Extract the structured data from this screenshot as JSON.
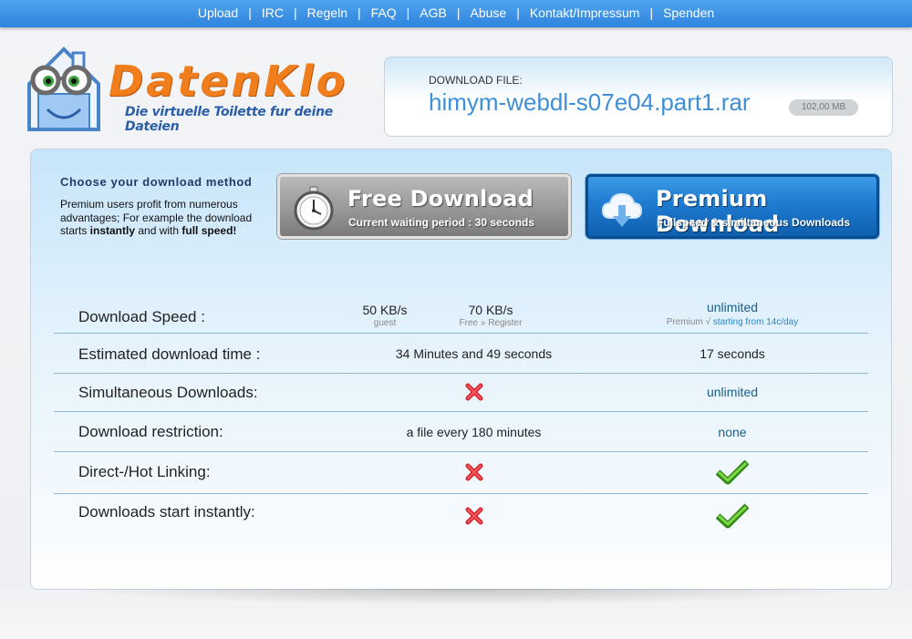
{
  "nav": {
    "items": [
      "Upload",
      "IRC",
      "Regeln",
      "FAQ",
      "AGB",
      "Abuse",
      "Kontakt/Impressum",
      "Spenden"
    ],
    "separator": "|"
  },
  "logo": {
    "name": "DatenKlo",
    "tagline": "Die virtuelle Toilette fur deine Dateien"
  },
  "file": {
    "label": "DOWNLOAD FILE:",
    "name": "himym-webdl-s07e04.part1.rar",
    "size": "102,00 MB"
  },
  "choose": {
    "title": "Choose your download method",
    "desc_1": "Premium users profit from numerous advantages; For example the download starts ",
    "desc_bold_1": "instantly",
    "desc_2": " and with ",
    "desc_bold_2": "full speed!"
  },
  "free_button": {
    "title": "Free Download",
    "subtitle": "Current waiting period : 30 seconds",
    "icon": "stopwatch-icon"
  },
  "premium_button": {
    "title": "Premium Download",
    "subtitle": "Fullspeed & similtaneous Downloads",
    "icon": "cloud-download-icon"
  },
  "comparison": {
    "speed": {
      "label": "Download Speed :",
      "guest_value": "50 KB/s",
      "guest_sub": "guest",
      "free_value": "70 KB/s",
      "free_sub": "Free » Register",
      "premium_value": "unlimited",
      "premium_note_prefix": "Premium √",
      "premium_note_link": "starting from 14c/day"
    },
    "time": {
      "label": "Estimated download time :",
      "free": "34 Minutes and 49 seconds",
      "premium": "17 seconds"
    },
    "simultaneous": {
      "label": "Simultaneous Downloads:",
      "free_icon": "red-x-icon",
      "premium": "unlimited"
    },
    "restriction": {
      "label": "Download restriction:",
      "free": "a file every 180 minutes",
      "premium": "none"
    },
    "hotlinking": {
      "label": "Direct-/Hot Linking:",
      "free_icon": "red-x-icon",
      "premium_icon": "green-check-icon"
    },
    "instant": {
      "label": "Downloads start instantly:",
      "free_icon": "red-x-icon",
      "premium_icon": "green-check-icon"
    }
  },
  "colors": {
    "nav_blue": "#3a94e6",
    "logo_orange": "#f07e1c",
    "file_name_blue": "#3d8fd8",
    "premium_blue": "#1f7bd1",
    "teal_text": "#1b5f87"
  }
}
